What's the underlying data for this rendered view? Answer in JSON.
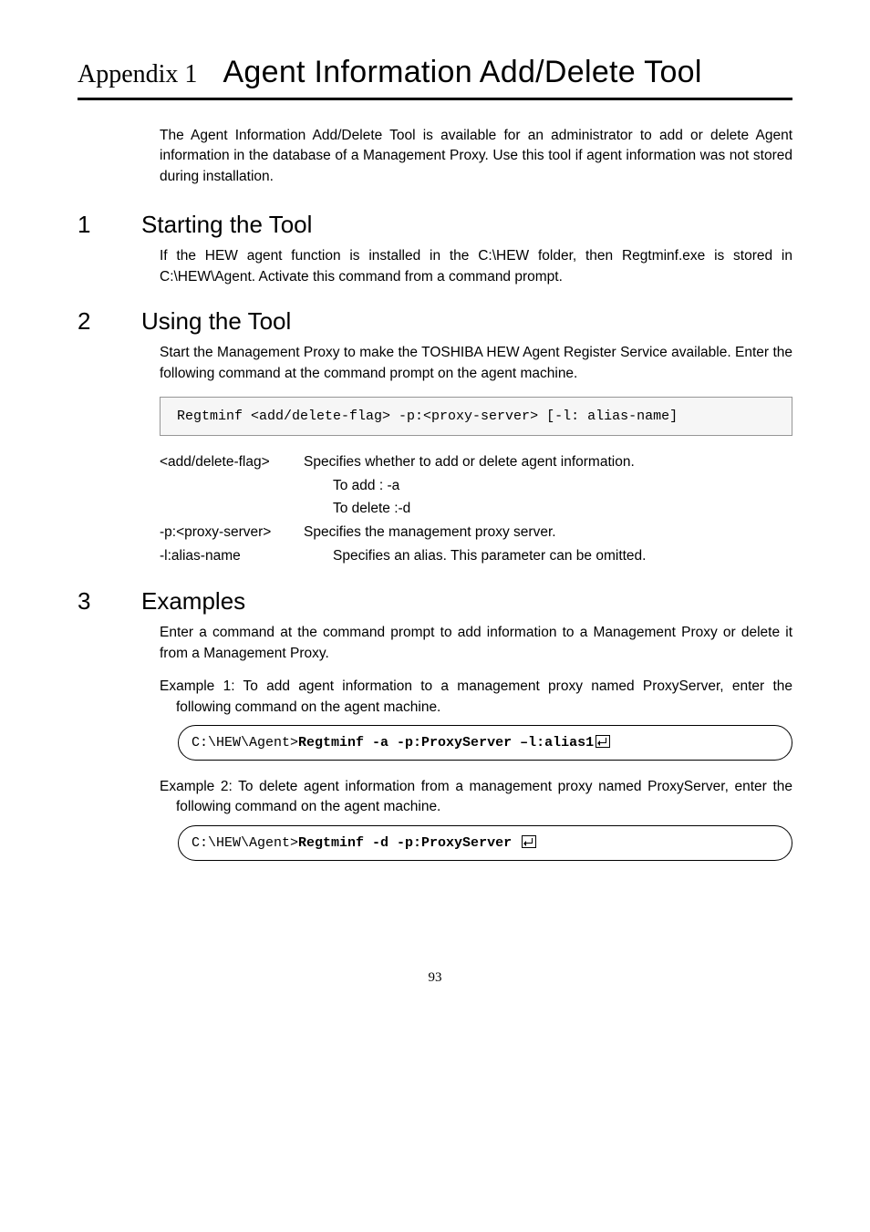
{
  "appendix_label": "Appendix 1",
  "appendix_title": "Agent Information Add/Delete Tool",
  "intro_text": "The Agent Information Add/Delete Tool is available for an administrator to add or delete Agent information in the database of a Management Proxy.    Use this tool if agent information was not stored during installation.",
  "sections": {
    "s1": {
      "num": "1",
      "title": "Starting the Tool",
      "body": "If the HEW agent function is installed in the C:\\HEW folder, then Regtminf.exe is stored in C:\\HEW\\Agent.    Activate this command from a command prompt."
    },
    "s2": {
      "num": "2",
      "title": "Using the Tool",
      "body": "Start the Management Proxy to make the TOSHIBA HEW Agent Register Service available.  Enter the following command at the command prompt on the agent machine.",
      "syntax": "Regtminf <add/delete-flag> -p:<proxy-server> [-l: alias-name]",
      "params": {
        "p1_key": "<add/delete-flag>",
        "p1_desc": "Specifies whether to add or delete agent information.",
        "p1_sub1": "To add : -a",
        "p1_sub2": "To delete :-d",
        "p2_key": "-p:<proxy-server>",
        "p2_desc": "Specifies the management proxy server.",
        "p3_key": "-l:alias-name",
        "p3_desc": "Specifies an alias.    This parameter can be omitted."
      }
    },
    "s3": {
      "num": "3",
      "title": "Examples",
      "body": "Enter a command at the command prompt to add information to a Management Proxy or delete it from a Management Proxy.",
      "ex1_text": "Example 1:   To add agent information to a management proxy named ProxyServer, enter the following command on the agent machine.",
      "ex1_cmd_prompt": "C:\\HEW\\Agent>",
      "ex1_cmd_bold": "Regtminf  -a -p:ProxyServer –l:alias1",
      "ex2_text": "Example 2:   To delete agent information from a management proxy named ProxyServer, enter the following command on the agent machine.",
      "ex2_cmd_prompt": "C:\\HEW\\Agent>",
      "ex2_cmd_bold": "Regtminf  -d -p:ProxyServer"
    }
  },
  "page_number": "93"
}
